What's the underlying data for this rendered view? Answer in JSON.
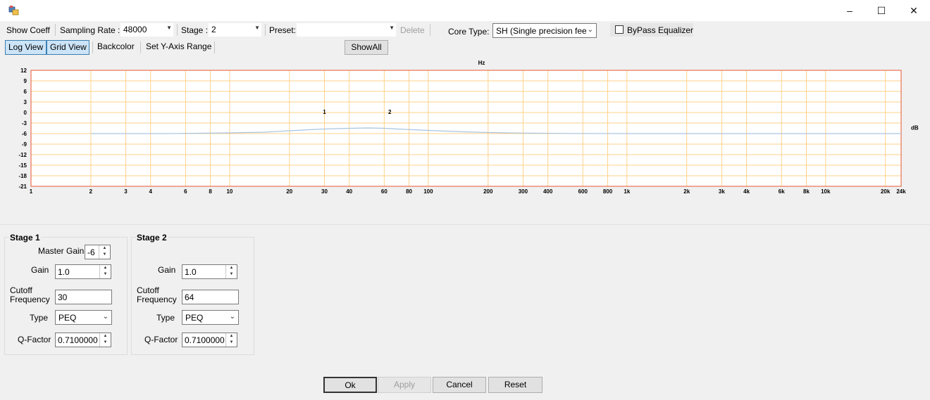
{
  "window": {
    "minimize": "–",
    "maximize": "☐",
    "close": "✕"
  },
  "toolbar": {
    "show_coeff": "Show Coeff",
    "sampling_rate_label": "Sampling Rate :",
    "sampling_rate_value": "48000",
    "stage_label": "Stage :",
    "stage_value": "2",
    "preset_label": "Preset:",
    "preset_value": "",
    "delete": "Delete",
    "core_type_label": "Core Type:",
    "core_type_value": "SH (Single precision feedb",
    "bypass_label": "ByPass Equalizer",
    "bypass_checked": false
  },
  "toolbar2": {
    "log_view": "Log View",
    "grid_view": "Grid View",
    "backcolor": "Backcolor",
    "set_y_axis": "Set Y-Axis Range",
    "show_all": "ShowAll"
  },
  "chart_data": {
    "type": "line",
    "x_scale": "log",
    "xlabel": "Hz",
    "ylabel": "dB",
    "xlim": [
      1,
      24000
    ],
    "ylim": [
      -21,
      12
    ],
    "y_ticks": [
      12,
      9,
      6,
      3,
      0,
      -3,
      -6,
      -9,
      -12,
      -15,
      -18,
      -21
    ],
    "x_ticks": [
      {
        "v": 1,
        "label": "1"
      },
      {
        "v": 2,
        "label": "2"
      },
      {
        "v": 3,
        "label": "3"
      },
      {
        "v": 4,
        "label": "4"
      },
      {
        "v": 6,
        "label": "6"
      },
      {
        "v": 8,
        "label": "8"
      },
      {
        "v": 10,
        "label": "10"
      },
      {
        "v": 20,
        "label": "20"
      },
      {
        "v": 30,
        "label": "30"
      },
      {
        "v": 40,
        "label": "40"
      },
      {
        "v": 60,
        "label": "60"
      },
      {
        "v": 80,
        "label": "80"
      },
      {
        "v": 100,
        "label": "100"
      },
      {
        "v": 200,
        "label": "200"
      },
      {
        "v": 300,
        "label": "300"
      },
      {
        "v": 400,
        "label": "400"
      },
      {
        "v": 600,
        "label": "600"
      },
      {
        "v": 800,
        "label": "800"
      },
      {
        "v": 1000,
        "label": "1k"
      },
      {
        "v": 2000,
        "label": "2k"
      },
      {
        "v": 3000,
        "label": "3k"
      },
      {
        "v": 4000,
        "label": "4k"
      },
      {
        "v": 6000,
        "label": "6k"
      },
      {
        "v": 8000,
        "label": "8k"
      },
      {
        "v": 10000,
        "label": "10k"
      },
      {
        "v": 20000,
        "label": "20k"
      },
      {
        "v": 24000,
        "label": "24k"
      }
    ],
    "grid": true,
    "colors": {
      "grid": "#ffd28a",
      "frame": "#e4572e",
      "curve": "#a9c4e0",
      "background": "#ffffff"
    },
    "series": [
      {
        "x": [
          2,
          5,
          10,
          15,
          20,
          25,
          30,
          40,
          50,
          60,
          70,
          100,
          150,
          200,
          300,
          500,
          1000,
          5000,
          24000
        ],
        "values": [
          -6.0,
          -6.0,
          -5.8,
          -5.6,
          -5.2,
          -4.9,
          -4.7,
          -4.5,
          -4.4,
          -4.5,
          -4.7,
          -5.1,
          -5.5,
          -5.7,
          -5.85,
          -5.95,
          -6.0,
          -6.0,
          -6.0
        ]
      }
    ],
    "markers": [
      {
        "label": "1",
        "x": 30,
        "y": 0
      },
      {
        "label": "2",
        "x": 64,
        "y": 0
      }
    ]
  },
  "stage1": {
    "title": "Stage 1",
    "master_gain_label": "Master Gain",
    "master_gain": "-6",
    "gain_label": "Gain",
    "gain": "1.0",
    "cutoff_label_1": "Cutoff",
    "cutoff_label_2": "Frequency",
    "cutoff": "30",
    "type_label": "Type",
    "type": "PEQ",
    "q_label": "Q-Factor",
    "q": "0.7100000"
  },
  "stage2": {
    "title": "Stage 2",
    "gain_label": "Gain",
    "gain": "1.0",
    "cutoff_label_1": "Cutoff",
    "cutoff_label_2": "Frequency",
    "cutoff": "64",
    "type_label": "Type",
    "type": "PEQ",
    "q_label": "Q-Factor",
    "q": "0.7100000"
  },
  "buttons": {
    "ok": "Ok",
    "apply": "Apply",
    "cancel": "Cancel",
    "reset": "Reset"
  }
}
